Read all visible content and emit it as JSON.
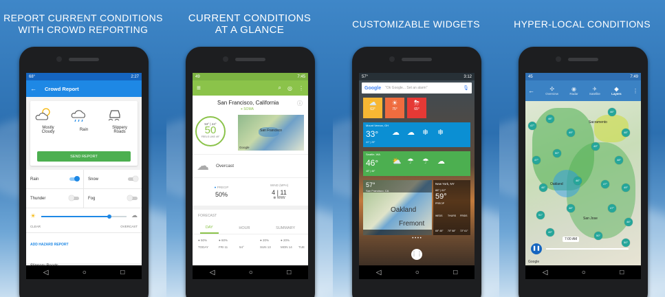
{
  "panel1": {
    "headline_1": "REPORT CURRENT CONDITIONS",
    "headline_2": "WITH CROWD REPORTING",
    "status_time": "2:27",
    "status_left": "68°",
    "toolbar_title": "Crowd Report",
    "conditions": [
      {
        "label": "Mostly\nCloudy",
        "icon": "partly-cloudy-icon"
      },
      {
        "label": "Rain",
        "icon": "rain-icon"
      },
      {
        "label": "Slippery\nRoads",
        "icon": "slippery-car-icon"
      }
    ],
    "send_label": "SEND REPORT",
    "toggles": [
      {
        "label": "Rain",
        "on": true
      },
      {
        "label": "Snow",
        "on": false
      },
      {
        "label": "Thunder",
        "on": false
      },
      {
        "label": "Fog",
        "on": false
      }
    ],
    "slider_value": 0.8,
    "slider_left": "CLEAR",
    "slider_right": "OVERCAST",
    "hazard_label": "ADD HAZARD REPORT",
    "partial_row": "Slippery Roads",
    "accent": "#1e88e5",
    "green": "#4caf50"
  },
  "panel2": {
    "headline_1": "CURRENT CONDITIONS",
    "headline_2": "AT A GLANCE",
    "status_time": "7:45",
    "status_left": "49",
    "city": "San Francisco, California",
    "hood": "SOMA",
    "temp": "50",
    "hi_lo": "53° | 44°",
    "feels": "FEELS LIKE 49°",
    "condition": "Overcast",
    "precip_label": "PRECIP",
    "precip_value": "50%",
    "wind_label": "WIND (MPH)",
    "wind_value": "4 | 11",
    "wind_dir": "NNW",
    "map_label": "San Francisco",
    "google": "Google",
    "forecast_label": "FORECAST",
    "tabs": [
      "DAY",
      "HOUR",
      "SUMMARY"
    ],
    "precips": [
      "50%",
      "60%",
      "20%",
      "20%"
    ],
    "days": [
      "TODAY",
      "FRI 11",
      "SAT 12",
      "SUN 13",
      "MON 14",
      "TUE"
    ],
    "temps": [
      "54°",
      "50°"
    ],
    "accent": "#8bc34a"
  },
  "panel3": {
    "headline": "CUSTOMIZABLE WIDGETS",
    "status_time": "3:12",
    "status_left": "57°",
    "google": "Google",
    "search_placeholder": "\"Ok Google... Set an alarm\"",
    "tiles": [
      {
        "temp": "63°",
        "color": "#f7b733"
      },
      {
        "temp": "75°",
        "color": "#ef6c3f"
      },
      {
        "temp": "65°",
        "color": "#e53935"
      }
    ],
    "w2_place": "Mount Vernon, OH",
    "w2_temp": "33°",
    "w2_hilo": "41° | 29°",
    "w3_place": "Seattle, WA",
    "w3_temp": "46°",
    "w3_hilo": "48° | 46°",
    "w4_temp": "57°",
    "w4_place": "San Francisco, CA",
    "w4_map1": "Oakland",
    "w4_map2": "Fremont",
    "w5_place": "New York, NY",
    "w5_hilo": "88° | 62°",
    "w5_temp": "59°",
    "w5_precip": "PRECIP",
    "w5_days": [
      "WEDS",
      "THURS",
      "FRIDS"
    ],
    "w5_temps": [
      "65° 45°",
      "70° 58°",
      "72° 61°"
    ],
    "blue": "#0b8fd3",
    "green": "#4caf50"
  },
  "panel4": {
    "headline": "HYPER-LOCAL CONDITIONS",
    "status_time": "7:49",
    "status_left": "45",
    "tabs": [
      "Overview",
      "Radar",
      "Satellite",
      "Layers"
    ],
    "active_tab": "Layers",
    "markers": [
      "47°",
      "48°",
      "49°",
      "46°",
      "48°",
      "47°",
      "50°",
      "49°",
      "48°",
      "46°",
      "46°",
      "47°",
      "49°",
      "51°",
      "48°",
      "47°",
      "46°",
      "49°",
      "50°",
      "50°"
    ],
    "cities": [
      "Sacramento",
      "Oakland",
      "San Jose"
    ],
    "time_label": "7:00 AM",
    "google": "Google",
    "teal": "#26a69a"
  },
  "nav": {
    "back": "◁",
    "home": "○",
    "recent": "□"
  }
}
